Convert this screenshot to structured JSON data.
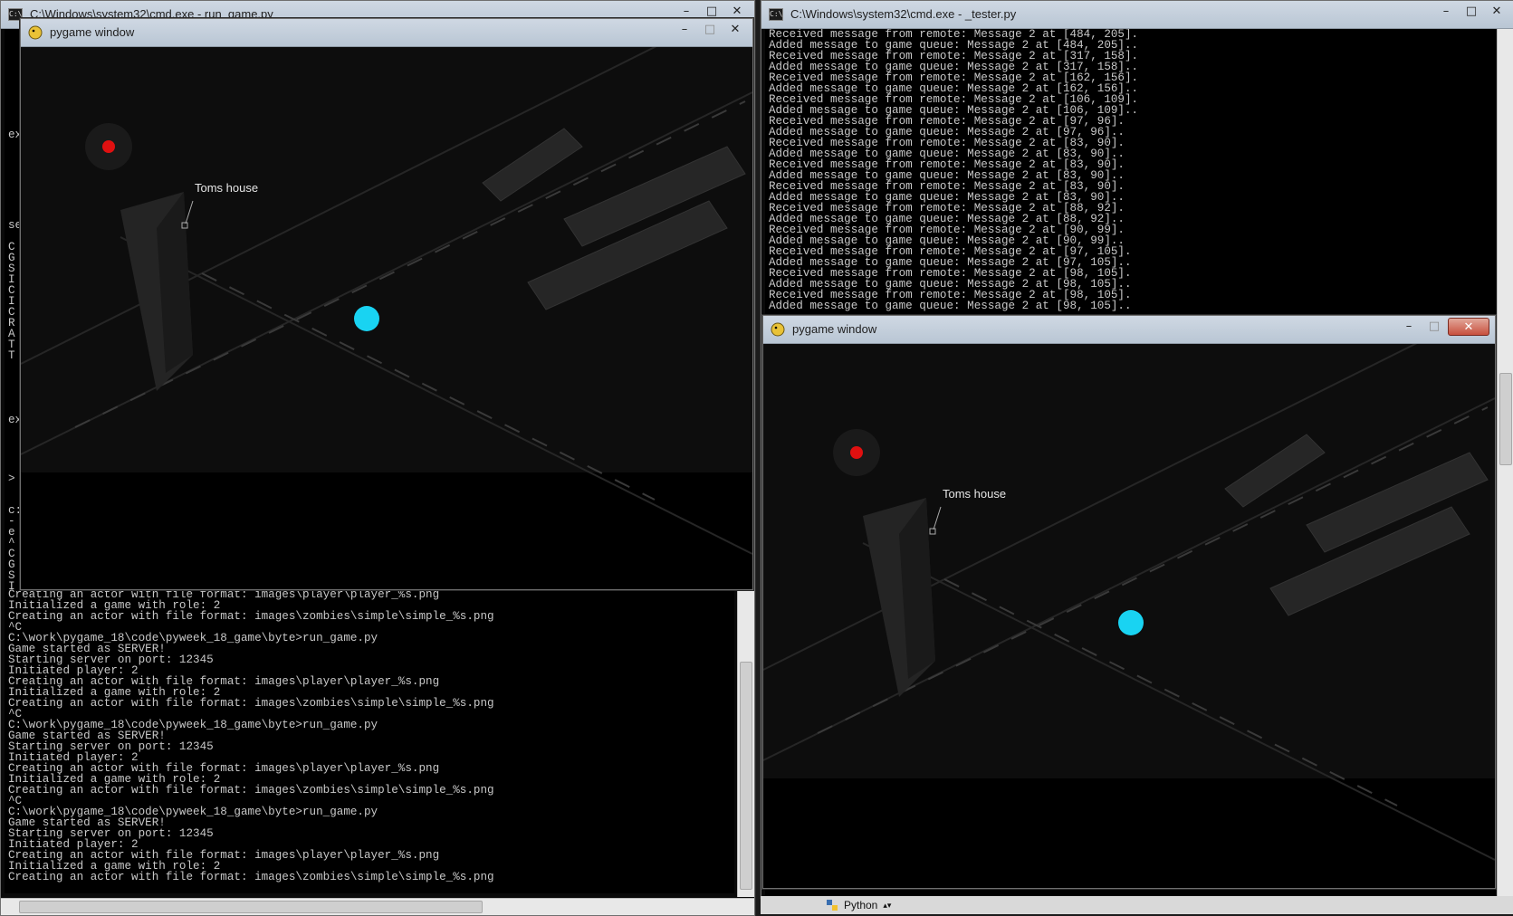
{
  "windows": {
    "cmd_left": {
      "title": "C:\\Windows\\system32\\cmd.exe - run_game.py",
      "fragments": [
        "ex",
        "se",
        "C",
        "G",
        "S",
        "I",
        "C",
        "I",
        "C",
        "R",
        "A",
        "T",
        "T",
        "ex",
        ">",
        "c:",
        "-",
        "e",
        "^",
        "C",
        "G",
        "S",
        "I"
      ],
      "lines": [
        "Creating an actor with file format: images\\player\\player_%s.png",
        "Initialized a game with role: 2",
        "Creating an actor with file format: images\\zombies\\simple\\simple_%s.png",
        "^C",
        "C:\\work\\pygame_18\\code\\pyweek_18_game\\byte>run_game.py",
        "Game started as SERVER!",
        "Starting server on port: 12345",
        "Initiated player: 2",
        "Creating an actor with file format: images\\player\\player_%s.png",
        "Initialized a game with role: 2",
        "Creating an actor with file format: images\\zombies\\simple\\simple_%s.png",
        "^C",
        "C:\\work\\pygame_18\\code\\pyweek_18_game\\byte>run_game.py",
        "Game started as SERVER!",
        "Starting server on port: 12345",
        "Initiated player: 2",
        "Creating an actor with file format: images\\player\\player_%s.png",
        "Initialized a game with role: 2",
        "Creating an actor with file format: images\\zombies\\simple\\simple_%s.png",
        "^C",
        "C:\\work\\pygame_18\\code\\pyweek_18_game\\byte>run_game.py",
        "Game started as SERVER!",
        "Starting server on port: 12345",
        "Initiated player: 2",
        "Creating an actor with file format: images\\player\\player_%s.png",
        "Initialized a game with role: 2",
        "Creating an actor with file format: images\\zombies\\simple\\simple_%s.png"
      ]
    },
    "pygame_left": {
      "title": "pygame window",
      "label": "Toms house"
    },
    "cmd_right": {
      "title": "C:\\Windows\\system32\\cmd.exe - _tester.py",
      "lines": [
        "Received message from remote: Message 2 at [484, 205].",
        "Added message to game queue: Message 2 at [484, 205]..",
        "Received message from remote: Message 2 at [317, 158].",
        "Added message to game queue: Message 2 at [317, 158]..",
        "Received message from remote: Message 2 at [162, 156].",
        "Added message to game queue: Message 2 at [162, 156]..",
        "Received message from remote: Message 2 at [106, 109].",
        "Added message to game queue: Message 2 at [106, 109]..",
        "Received message from remote: Message 2 at [97, 96].",
        "Added message to game queue: Message 2 at [97, 96]..",
        "Received message from remote: Message 2 at [83, 90].",
        "Added message to game queue: Message 2 at [83, 90]..",
        "Received message from remote: Message 2 at [83, 90].",
        "Added message to game queue: Message 2 at [83, 90]..",
        "Received message from remote: Message 2 at [83, 90].",
        "Added message to game queue: Message 2 at [83, 90]..",
        "Received message from remote: Message 2 at [88, 92].",
        "Added message to game queue: Message 2 at [88, 92]..",
        "Received message from remote: Message 2 at [90, 99].",
        "Added message to game queue: Message 2 at [90, 99]..",
        "Received message from remote: Message 2 at [97, 105].",
        "Added message to game queue: Message 2 at [97, 105]..",
        "Received message from remote: Message 2 at [98, 105].",
        "Added message to game queue: Message 2 at [98, 105]..",
        "Received message from remote: Message 2 at [98, 105].",
        "Added message to game queue: Message 2 at [98, 105].."
      ]
    },
    "pygame_right": {
      "title": "pygame window",
      "label": "Toms house"
    }
  },
  "taskbar": {
    "item_label": "Python"
  },
  "colors": {
    "player": "#19d3f2",
    "zombie": "#e01010"
  }
}
